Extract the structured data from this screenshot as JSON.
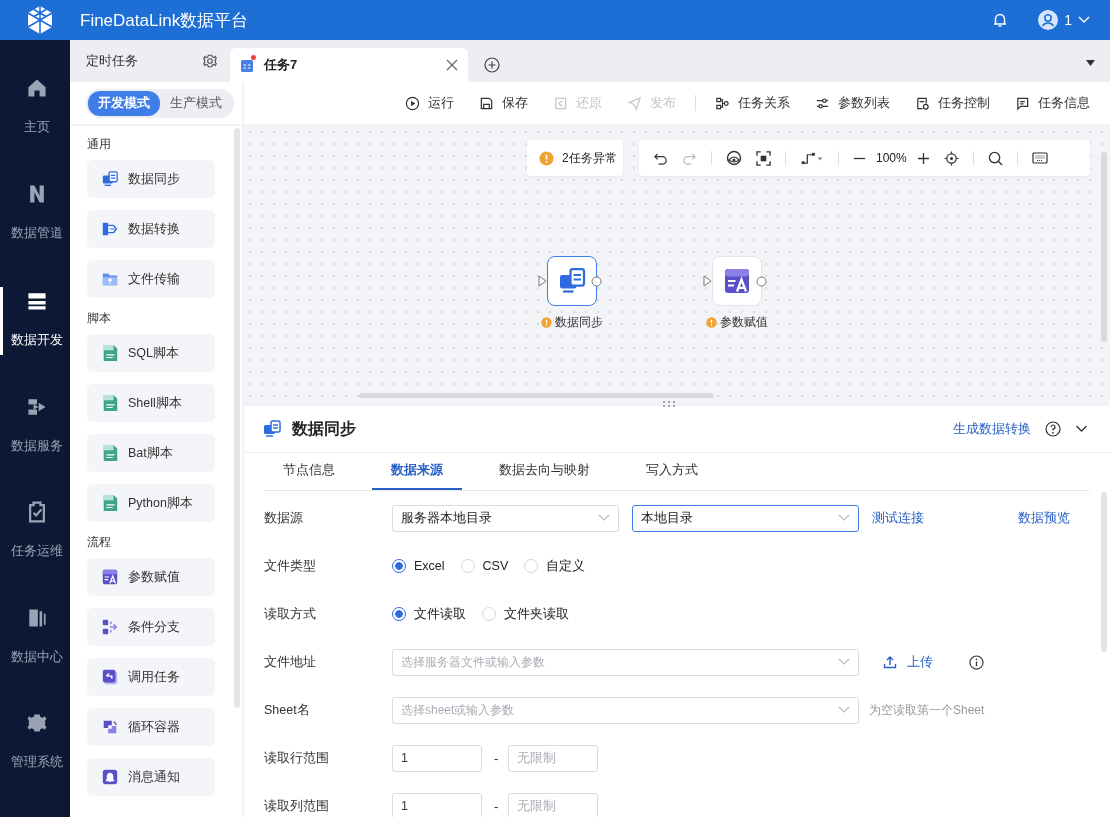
{
  "app": {
    "title": "FineDataLink数据平台",
    "user": "1"
  },
  "nav": [
    {
      "label": "主页",
      "kind": "home",
      "selected": false
    },
    {
      "label": "数据管道",
      "kind": "pipe",
      "selected": false
    },
    {
      "label": "数据开发",
      "kind": "dev",
      "selected": true
    },
    {
      "label": "数据服务",
      "kind": "service",
      "selected": false
    },
    {
      "label": "任务运维",
      "kind": "ops",
      "selected": false
    },
    {
      "label": "数据中心",
      "kind": "center",
      "selected": false
    },
    {
      "label": "管理系统",
      "kind": "gear",
      "selected": false
    }
  ],
  "side_tab": {
    "label": "定时任务"
  },
  "tabs": [
    {
      "label": "任务7",
      "selected": true,
      "unsaved": true
    }
  ],
  "modes": [
    {
      "label": "开发模式",
      "selected": true
    },
    {
      "label": "生产模式",
      "selected": false
    }
  ],
  "actions": [
    {
      "label": "运行",
      "kind": "play",
      "disabled": false
    },
    {
      "label": "保存",
      "kind": "save",
      "disabled": false
    },
    {
      "label": "还原",
      "kind": "restore",
      "disabled": true
    },
    {
      "label": "发布",
      "kind": "send",
      "disabled": true
    },
    {
      "label": "任务关系",
      "kind": "relation",
      "disabled": false
    },
    {
      "label": "参数列表",
      "kind": "sliders",
      "disabled": false
    },
    {
      "label": "任务控制",
      "kind": "control",
      "disabled": false
    },
    {
      "label": "任务信息",
      "kind": "info",
      "disabled": false
    }
  ],
  "palette": [
    {
      "heading": "通用",
      "items": [
        {
          "label": "数据同步",
          "kind": "sync"
        },
        {
          "label": "数据转换",
          "kind": "transform"
        },
        {
          "label": "文件传输",
          "kind": "folder"
        }
      ]
    },
    {
      "heading": "脚本",
      "items": [
        {
          "label": "SQL脚本",
          "kind": "script"
        },
        {
          "label": "Shell脚本",
          "kind": "script"
        },
        {
          "label": "Bat脚本",
          "kind": "script"
        },
        {
          "label": "Python脚本",
          "kind": "script"
        }
      ]
    },
    {
      "heading": "流程",
      "items": [
        {
          "label": "参数赋值",
          "kind": "param"
        },
        {
          "label": "条件分支",
          "kind": "branch"
        },
        {
          "label": "调用任务",
          "kind": "call"
        },
        {
          "label": "循环容器",
          "kind": "loop"
        },
        {
          "label": "消息通知",
          "kind": "bell"
        }
      ]
    }
  ],
  "canvas": {
    "warning": "2任务异常",
    "zoom": "100%",
    "nodes": [
      {
        "label": "数据同步",
        "kind": "sync",
        "selected": true,
        "warning": true
      },
      {
        "label": "参数赋值",
        "kind": "param",
        "selected": false,
        "warning": true
      }
    ]
  },
  "panel": {
    "title": "数据同步",
    "link": "生成数据转换",
    "tabs": [
      {
        "label": "节点信息",
        "selected": false
      },
      {
        "label": "数据来源",
        "selected": true
      },
      {
        "label": "数据去向与映射",
        "selected": false
      },
      {
        "label": "写入方式",
        "selected": false
      }
    ],
    "fields": [
      {
        "label": "数据源",
        "kind": "source",
        "selects": [
          {
            "value": "服务器本地目录",
            "focused": false
          },
          {
            "value": "本地目录",
            "focused": true
          }
        ],
        "links": [
          "测试连接",
          "数据预览"
        ]
      },
      {
        "label": "文件类型",
        "kind": "radio",
        "options": [
          {
            "label": "Excel",
            "selected": true
          },
          {
            "label": "CSV",
            "selected": false
          },
          {
            "label": "自定义",
            "selected": false
          }
        ]
      },
      {
        "label": "读取方式",
        "kind": "radio",
        "options": [
          {
            "label": "文件读取",
            "selected": true
          },
          {
            "label": "文件夹读取",
            "selected": false
          }
        ]
      },
      {
        "label": "文件地址",
        "kind": "upload",
        "placeholder": "选择服务器文件或输入参数",
        "button": "上传"
      },
      {
        "label": "Sheet名",
        "kind": "hint",
        "placeholder": "选择sheet或输入参数",
        "hint": "为空读取第一个Sheet"
      },
      {
        "label": "读取行范围",
        "kind": "range",
        "from": "1",
        "separator": "-",
        "to_placeholder": "无限制"
      },
      {
        "label": "读取列范围",
        "kind": "range",
        "from": "1",
        "separator": "-",
        "to_placeholder": "无限制"
      }
    ]
  }
}
